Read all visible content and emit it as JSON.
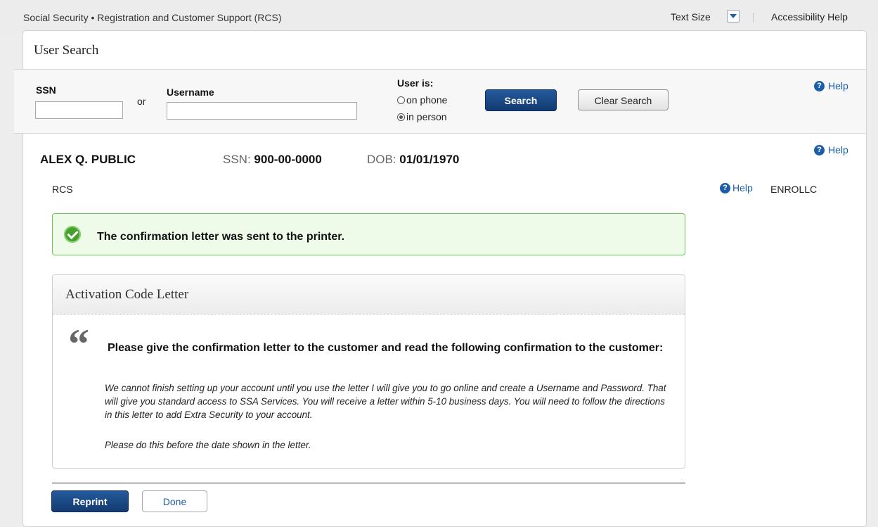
{
  "header": {
    "app_title": "Social Security • Registration and Customer Support (RCS)",
    "text_size_label": "Text Size",
    "accessibility_label": "Accessibility Help"
  },
  "panel": {
    "title": "User Search"
  },
  "search": {
    "ssn_label": "SSN",
    "ssn_value": "",
    "or_label": "or",
    "username_label": "Username",
    "username_value": "",
    "user_is_label": "User is:",
    "options": [
      {
        "label": "on phone",
        "checked": false
      },
      {
        "label": "in person",
        "checked": true
      }
    ],
    "search_button": "Search",
    "clear_button": "Clear Search",
    "help_label": "Help"
  },
  "person": {
    "name": "ALEX Q. PUBLIC",
    "ssn_key": "SSN:",
    "ssn_value": "900-00-0000",
    "dob_key": "DOB:",
    "dob_value": "01/01/1970",
    "help_label": "Help"
  },
  "context": {
    "left_label": "RCS",
    "help_label": "Help",
    "code": "ENROLLC"
  },
  "alert": {
    "text": "The confirmation letter was sent to the printer.",
    "status_color": "#45a02c"
  },
  "card": {
    "title": "Activation Code Letter",
    "quote_mark": "“",
    "instruction": "Please give the confirmation letter to the customer and read the following confirmation to the customer:",
    "script": "We cannot finish setting up your account until you use the letter I will give you to go online and create a Username and Password. That will give you standard access to SSA Services. You will receive a letter within 5-10 business days. You will need to follow the directions in this letter to add Extra Security to your account.",
    "note": "Please do this before the date shown in the letter."
  },
  "actions": {
    "reprint": "Reprint",
    "done": "Done"
  },
  "colors": {
    "primary_button": "#15407a",
    "link": "#1d5ea8",
    "success_border": "#6fc25b"
  }
}
